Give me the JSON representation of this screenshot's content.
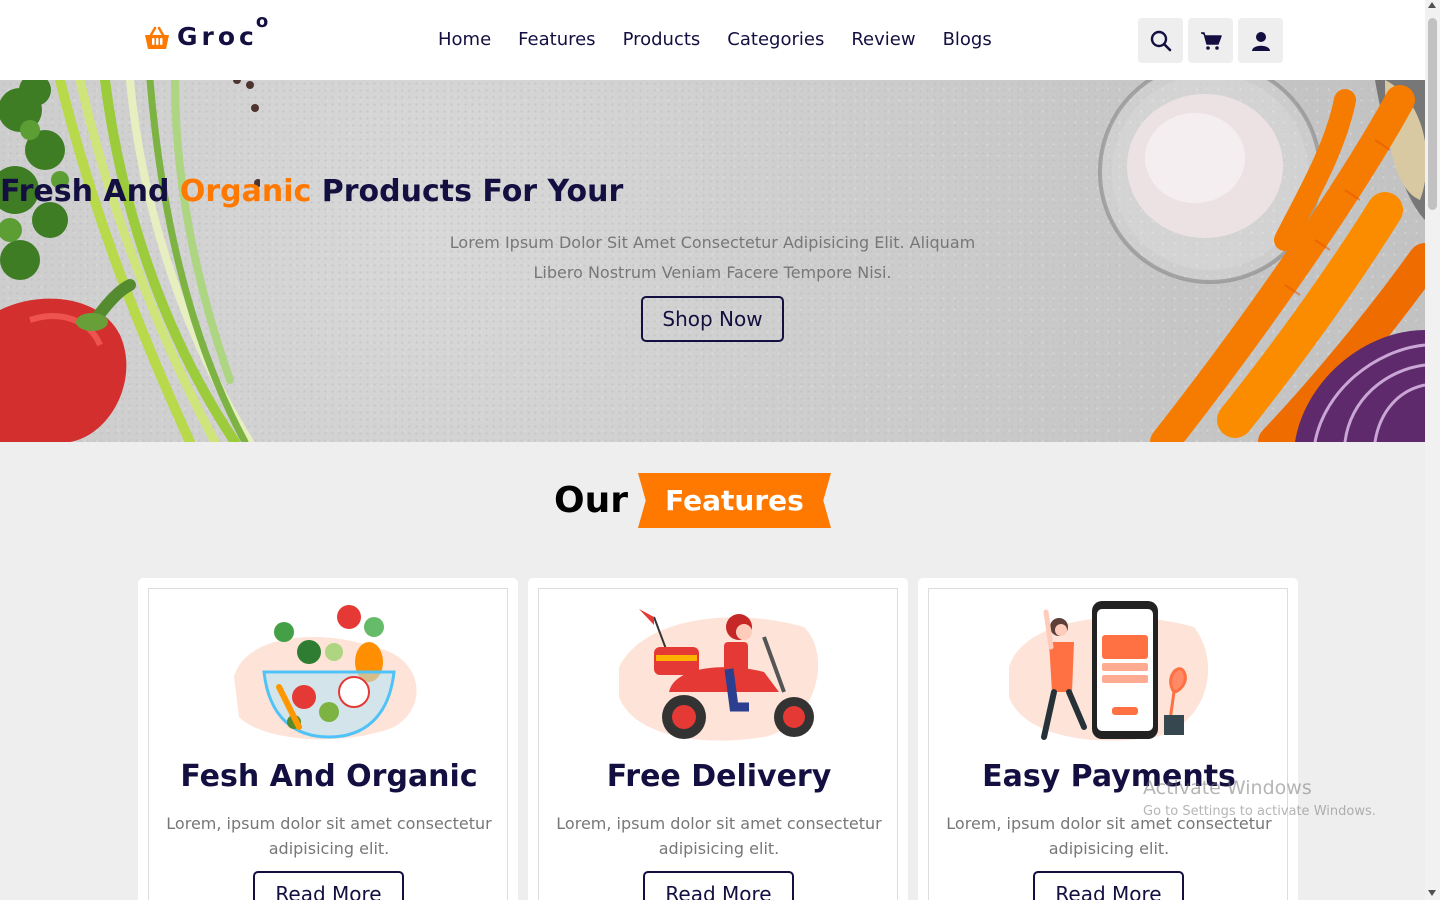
{
  "header": {
    "logo_text": "Groc",
    "logo_sup": "o",
    "nav": [
      "Home",
      "Features",
      "Products",
      "Categories",
      "Review",
      "Blogs"
    ],
    "icons": [
      "search-icon",
      "cart-icon",
      "user-icon"
    ]
  },
  "hero": {
    "title_part1": "Fresh And ",
    "title_accent": "Organic",
    "title_part2": " Products For Your",
    "description": "Lorem Ipsum Dolor Sit Amet Consectetur Adipisicing Elit. Aliquam Libero Nostrum Veniam Facere Tempore Nisi.",
    "button": "Shop Now"
  },
  "features": {
    "heading_plain": "Our",
    "heading_tag": "Features",
    "cards": [
      {
        "title": "Fesh And Organic",
        "desc": "Lorem, ipsum dolor sit amet consectetur adipisicing elit.",
        "button": "Read More"
      },
      {
        "title": "Free Delivery",
        "desc": "Lorem, ipsum dolor sit amet consectetur adipisicing elit.",
        "button": "Read More"
      },
      {
        "title": "Easy Payments",
        "desc": "Lorem, ipsum dolor sit amet consectetur adipisicing elit.",
        "button": "Read More"
      }
    ]
  },
  "watermark": {
    "line1": "Activate Windows",
    "line2": "Go to Settings to activate Windows."
  },
  "colors": {
    "accent": "#ff7800",
    "dark": "#130f40",
    "text_light": "#777777",
    "background": "#eeeeee"
  }
}
